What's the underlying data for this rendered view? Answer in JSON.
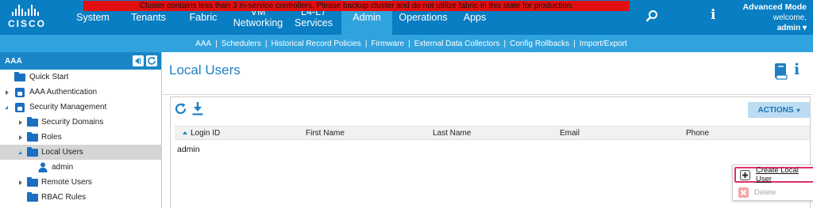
{
  "alert": {
    "text": "Cluster contains less than 3 in-service controllers. Please backup cluster and do not utilize fabric in this state for production."
  },
  "logo": {
    "text": "CISCO"
  },
  "nav": {
    "items": [
      {
        "label": "System"
      },
      {
        "label": "Tenants"
      },
      {
        "label": "Fabric"
      },
      {
        "label": "VM\nNetworking"
      },
      {
        "label": "L4-L7\nServices"
      },
      {
        "label": "Admin"
      },
      {
        "label": "Operations"
      },
      {
        "label": "Apps"
      }
    ],
    "active": "Admin"
  },
  "header_right": {
    "mode": "Advanced Mode",
    "welcome": "welcome,",
    "user": "admin ▾"
  },
  "subnav": {
    "links": [
      {
        "label": "AAA"
      },
      {
        "label": "Schedulers"
      },
      {
        "label": "Historical Record Policies"
      },
      {
        "label": "Firmware"
      },
      {
        "label": "External Data Collectors"
      },
      {
        "label": "Config Rollbacks"
      },
      {
        "label": "Import/Export"
      }
    ],
    "separator": "|"
  },
  "sidebar": {
    "title": "AAA",
    "tree": [
      {
        "label": "Quick Start"
      },
      {
        "label": "AAA Authentication"
      },
      {
        "label": "Security Management"
      },
      {
        "label": "Security Domains"
      },
      {
        "label": "Roles"
      },
      {
        "label": "Local Users"
      },
      {
        "label": "admin"
      },
      {
        "label": "Remote Users"
      },
      {
        "label": "RBAC Rules"
      }
    ]
  },
  "main": {
    "title": "Local Users",
    "info_glyph": "i",
    "actions_label": "ACTIONS",
    "actions_caret": "▾",
    "table": {
      "columns": [
        {
          "label": "Login ID"
        },
        {
          "label": "First Name"
        },
        {
          "label": "Last Name"
        },
        {
          "label": "Email"
        },
        {
          "label": "Phone"
        }
      ],
      "rows": [
        {
          "login_id": "admin"
        }
      ]
    },
    "actions_menu": {
      "items": [
        {
          "label": "Create Local User",
          "enabled": true
        },
        {
          "label": "Delete",
          "enabled": false
        }
      ]
    }
  },
  "colors": {
    "topbar": "#0a7ec2",
    "active_tab": "#30a2dd",
    "subnav": "#30a2dd",
    "alert": "#e10f0f",
    "title": "#1f7fc4",
    "highlight": "#e0306a"
  },
  "icons": {
    "search": "search-icon",
    "info": "info-icon",
    "refresh": "refresh-icon",
    "download": "download-icon",
    "book": "book-icon",
    "folder": "folder-icon",
    "lock": "lock-icon",
    "user": "user-icon"
  }
}
